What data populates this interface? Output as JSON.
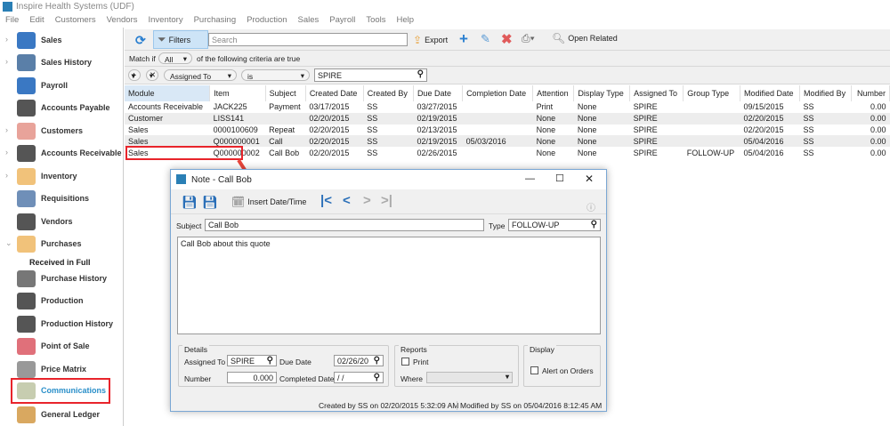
{
  "app": {
    "title": "Inspire Health Systems (UDF)"
  },
  "menu": [
    "File",
    "Edit",
    "Customers",
    "Vendors",
    "Inventory",
    "Purchasing",
    "Production",
    "Sales",
    "Payroll",
    "Tools",
    "Help"
  ],
  "sidebar": {
    "items": [
      {
        "label": "Sales",
        "icon": "cart-icon",
        "expandable": true,
        "color": "#3a78c3"
      },
      {
        "label": "Sales History",
        "icon": "clock-cart-icon",
        "expandable": true,
        "color": "#5a7fa8"
      },
      {
        "label": "Payroll",
        "icon": "payroll-icon",
        "expandable": false,
        "color": "#3a78c3"
      },
      {
        "label": "Accounts Payable",
        "icon": "safe-arrow-icon",
        "expandable": false,
        "color": "#555"
      },
      {
        "label": "Customers",
        "icon": "person-icon",
        "expandable": true,
        "color": "#e8a39a"
      },
      {
        "label": "Accounts Receivable",
        "icon": "safe-arrow-in-icon",
        "expandable": true,
        "color": "#555"
      },
      {
        "label": "Inventory",
        "icon": "box-icon",
        "expandable": true,
        "color": "#f1c27a"
      },
      {
        "label": "Requisitions",
        "icon": "truck-icon",
        "expandable": false,
        "color": "#6f8fb8"
      },
      {
        "label": "Vendors",
        "icon": "factory-icon",
        "expandable": false,
        "color": "#555"
      },
      {
        "label": "Purchases",
        "icon": "bag-icon",
        "expandable": true,
        "expanded": true,
        "color": "#f1c27a"
      },
      {
        "label": "Purchase History",
        "icon": "clock-bag-icon",
        "expandable": false,
        "color": "#777"
      },
      {
        "label": "Production",
        "icon": "gears-icon",
        "expandable": false,
        "color": "#555"
      },
      {
        "label": "Production History",
        "icon": "gears-icon",
        "expandable": false,
        "color": "#555"
      },
      {
        "label": "Point of Sale",
        "icon": "store-icon",
        "expandable": false,
        "color": "#e0707a"
      },
      {
        "label": "Price Matrix",
        "icon": "grid-icon",
        "expandable": false,
        "color": "#999"
      },
      {
        "label": "Communications",
        "icon": "note-icon",
        "expandable": false,
        "active": true,
        "color": "#c7cdb0"
      },
      {
        "label": "General Ledger",
        "icon": "bank-icon",
        "expandable": false,
        "color": "#d9a860"
      }
    ],
    "subitem": "Received in Full"
  },
  "toolbar": {
    "filters": "Filters",
    "search_placeholder": "Search",
    "export": "Export",
    "open_related": "Open Related"
  },
  "filter": {
    "match_prefix": "Match if",
    "match_value": "All",
    "match_suffix": "of the following criteria are true",
    "field": "Assigned To",
    "operator": "is",
    "value": "SPIRE"
  },
  "table": {
    "columns": [
      "Module",
      "Item",
      "Subject",
      "Created Date",
      "Created By",
      "Due Date",
      "Completion Date",
      "Attention",
      "Display Type",
      "Assigned To",
      "Group Type",
      "Modified Date",
      "Modified By",
      "Number"
    ],
    "rows": [
      [
        "Accounts Receivable",
        "JACK225",
        "Payment",
        "03/17/2015",
        "SS",
        "03/27/2015",
        "",
        "Print",
        "None",
        "SPIRE",
        "",
        "09/15/2015",
        "SS",
        "0.00"
      ],
      [
        "Customer",
        "LISS141",
        "",
        "02/20/2015",
        "SS",
        "02/19/2015",
        "",
        "None",
        "None",
        "SPIRE",
        "",
        "02/20/2015",
        "SS",
        "0.00"
      ],
      [
        "Sales",
        "0000100609",
        "Repeat",
        "02/20/2015",
        "SS",
        "02/13/2015",
        "",
        "None",
        "None",
        "SPIRE",
        "",
        "02/20/2015",
        "SS",
        "0.00"
      ],
      [
        "Sales",
        "Q000000001",
        "Call",
        "02/20/2015",
        "SS",
        "02/19/2015",
        "05/03/2016",
        "None",
        "None",
        "SPIRE",
        "",
        "05/04/2016",
        "SS",
        "0.00"
      ],
      [
        "Sales",
        "Q000000002",
        "Call Bob",
        "02/20/2015",
        "SS",
        "02/26/2015",
        "",
        "None",
        "None",
        "SPIRE",
        "FOLLOW-UP",
        "05/04/2016",
        "SS",
        "0.00"
      ]
    ]
  },
  "dialog": {
    "title": "Note - Call Bob",
    "insert_datetime": "Insert Date/Time",
    "subject_label": "Subject",
    "subject": "Call Bob",
    "type_label": "Type",
    "type": "FOLLOW-UP",
    "body": "Call Bob about this quote",
    "details_label": "Details",
    "assigned_label": "Assigned To",
    "assigned": "SPIRE",
    "due_label": "Due Date",
    "due": "02/26/20",
    "number_label": "Number",
    "number": "0.000",
    "completed_label": "Completed Date",
    "completed": " / /",
    "reports_label": "Reports",
    "print_label": "Print",
    "print_checked": false,
    "where_label": "Where",
    "where": "",
    "display_label": "Display",
    "alert_label": "Alert on Orders",
    "alert_checked": false,
    "created": "Created by SS on 02/20/2015 5:32:09 AM",
    "modified": "Modified by SS on 05/04/2016 8:12:45 AM"
  },
  "colors": {
    "highlight": "#e8242b",
    "accent": "#3a78c3",
    "filter_active": "#cde4f7"
  }
}
